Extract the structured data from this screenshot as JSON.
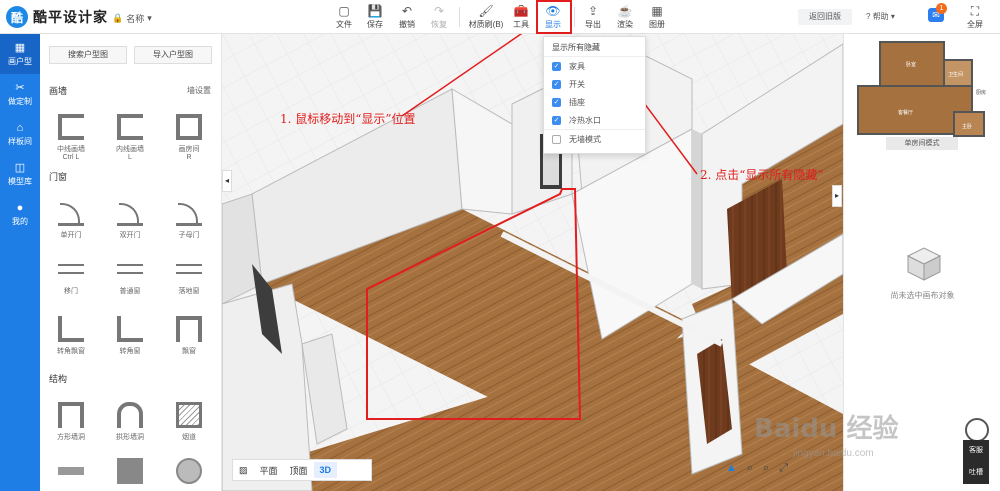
{
  "app": {
    "logo_mark": "酷",
    "logo_text": "酷平设计家",
    "project_name": "名称",
    "back_old": "返回旧版",
    "help": "帮助",
    "notif_count": "1",
    "fullscreen": "全屏"
  },
  "toolbar": [
    {
      "label": "文件",
      "icon": "▢"
    },
    {
      "label": "保存",
      "icon": "💾"
    },
    {
      "label": "撤销",
      "icon": "↶"
    },
    {
      "label": "恢复",
      "icon": "↷"
    },
    {
      "label": "材质刷(B)",
      "icon": "🖌"
    },
    {
      "label": "工具",
      "icon": "🧰"
    },
    {
      "label": "显示",
      "icon": "👁"
    },
    {
      "label": "导出",
      "icon": "⇪"
    },
    {
      "label": "渲染",
      "icon": "☕"
    },
    {
      "label": "图册",
      "icon": "▦"
    }
  ],
  "leftnav": [
    {
      "label": "画户型",
      "icon": "▦"
    },
    {
      "label": "做定制",
      "icon": "✂"
    },
    {
      "label": "样板间",
      "icon": "⌂"
    },
    {
      "label": "模型库",
      "icon": "◫"
    },
    {
      "label": "我的",
      "icon": "●"
    }
  ],
  "panel": {
    "search_btn": "搜索户型图",
    "import_btn": "导入户型图",
    "wall_title": "画墙",
    "wall_settings": "墙设置",
    "walls": [
      {
        "label": "中线画墙",
        "sub": "Ctrl L"
      },
      {
        "label": "内线画墙",
        "sub": "L"
      },
      {
        "label": "画房间",
        "sub": "R"
      }
    ],
    "door_title": "门窗",
    "doors": [
      {
        "label": "单开门"
      },
      {
        "label": "双开门"
      },
      {
        "label": "子母门"
      },
      {
        "label": "移门"
      },
      {
        "label": "普通窗"
      },
      {
        "label": "落地窗"
      },
      {
        "label": "转角飘窗"
      },
      {
        "label": "转角窗"
      },
      {
        "label": "飘窗"
      }
    ],
    "struct_title": "结构",
    "structs": [
      {
        "label": "方形墙洞"
      },
      {
        "label": "拱形墙洞"
      },
      {
        "label": "烟道"
      }
    ]
  },
  "dropdown": {
    "header": "显示所有隐藏",
    "items": [
      {
        "label": "家具",
        "checked": true
      },
      {
        "label": "开关",
        "checked": true
      },
      {
        "label": "插座",
        "checked": true
      },
      {
        "label": "冷热水口",
        "checked": true
      },
      {
        "label": "无墙模式",
        "checked": false
      }
    ]
  },
  "viewbar": {
    "plan": "平面",
    "top": "顶面",
    "d3": "3D"
  },
  "rightpanel": {
    "rooms": [
      "卧室",
      "卫生间",
      "厨房",
      "客餐厅",
      "主卧"
    ],
    "single_mode": "单房间模式",
    "empty_text": "尚未选中画布对象"
  },
  "support": {
    "kefu": "客服",
    "tucao": "吐槽"
  },
  "annotations": {
    "step1": "1. 鼠标移动到“显示”位置",
    "step2": "2. 点击“显示所有隐藏”"
  },
  "watermark": {
    "main": "Baidu 经验",
    "sub": "jingyan.baidu.com"
  }
}
